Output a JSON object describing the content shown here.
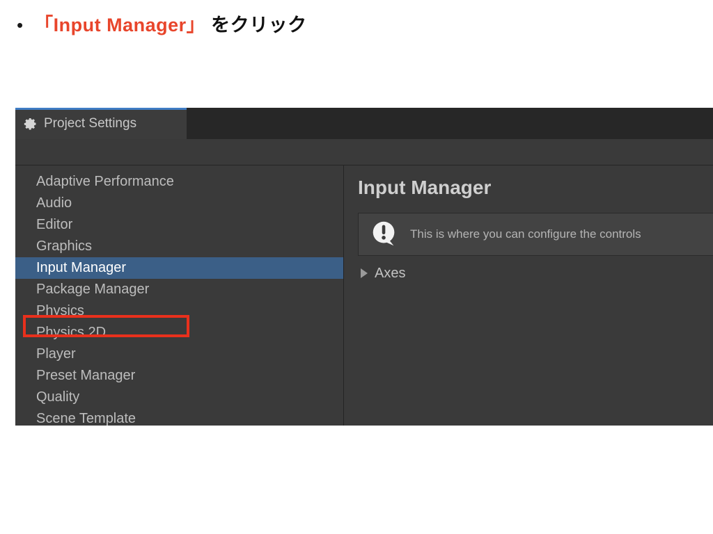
{
  "slide": {
    "bullet_marker": "•",
    "text_prefix": "",
    "highlight": "「Input Manager」",
    "text_suffix": " をクリック",
    "highlight_color": "#e8452b",
    "text_color": "#111111"
  },
  "window": {
    "tab": {
      "label": "Project Settings",
      "icon": "gear-icon",
      "accent_color": "#3f7cc4",
      "active_bg": "#3c3c3c",
      "strip_bg": "#272727"
    },
    "sidebar": {
      "bg": "#3a3a3a",
      "selected_bg": "#3b5f87",
      "items": [
        {
          "label": "Adaptive Performance",
          "selected": false
        },
        {
          "label": "Audio",
          "selected": false
        },
        {
          "label": "Editor",
          "selected": false
        },
        {
          "label": "Graphics",
          "selected": false
        },
        {
          "label": "Input Manager",
          "selected": true
        },
        {
          "label": "Package Manager",
          "selected": false
        },
        {
          "label": "Physics",
          "selected": false
        },
        {
          "label": "Physics 2D",
          "selected": false
        },
        {
          "label": "Player",
          "selected": false
        },
        {
          "label": "Preset Manager",
          "selected": false
        },
        {
          "label": "Quality",
          "selected": false
        },
        {
          "label": "Scene Template",
          "selected": false
        }
      ]
    },
    "annotation": {
      "target": "Input Manager",
      "color": "#e8301c"
    },
    "detail": {
      "title": "Input Manager",
      "help": {
        "icon": "info-exclamation-icon",
        "text": "This is where you can configure the controls"
      },
      "foldout": {
        "label": "Axes",
        "expanded": false,
        "arrow": "triangle-right-icon"
      }
    }
  }
}
